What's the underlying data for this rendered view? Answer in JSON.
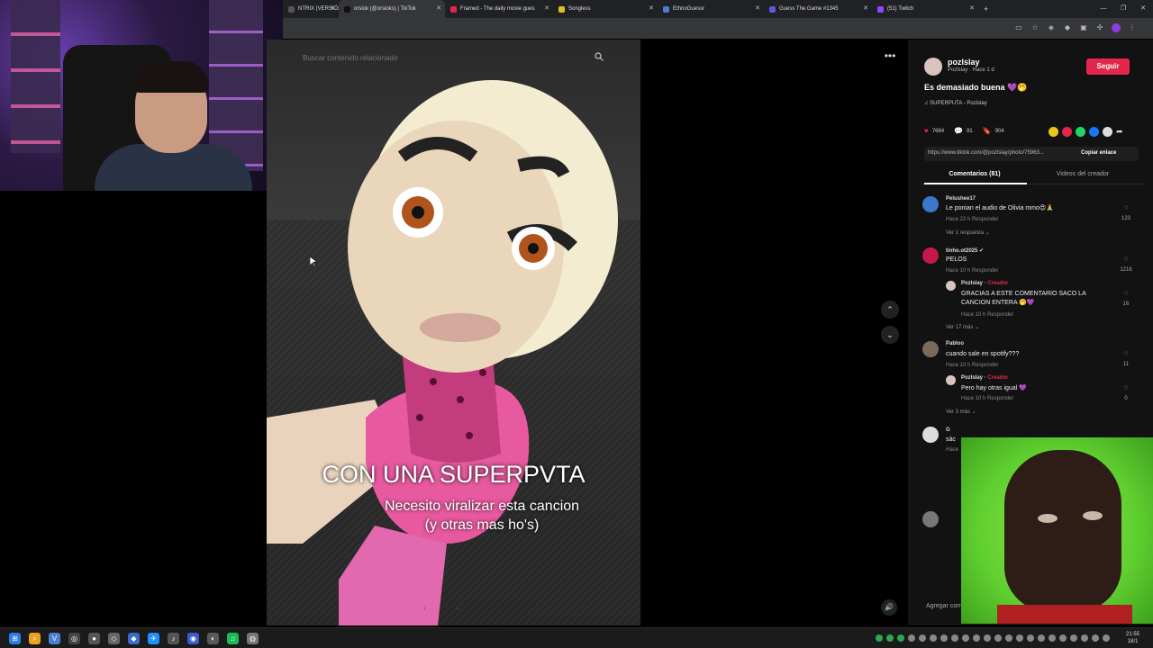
{
  "browser": {
    "tabs": [
      {
        "label": "NTRIX (VERSIÓN",
        "color": "#555555"
      },
      {
        "label": "orsiok (@orsioks) | TikTok",
        "color": "#111111",
        "active": true
      },
      {
        "label": "Framed - The daily movie gues",
        "color": "#e3274c"
      },
      {
        "label": "Songless",
        "color": "#e0c020"
      },
      {
        "label": "EthnoGuessr",
        "color": "#4a7fd0"
      },
      {
        "label": "Guess The.Game #1345",
        "color": "#5a5ae0"
      },
      {
        "label": "(51) Twitch",
        "color": "#9146ff"
      }
    ],
    "new_tab": "+",
    "window_controls": [
      "—",
      "❐",
      "✕"
    ]
  },
  "video": {
    "search_placeholder": "Buscar contenido relacionado",
    "caption_big": "CON UNA SUPERPVTA",
    "caption_small": "Necesito viralizar esta cancion (y otras mas ho's)",
    "more_icon": "•••",
    "up_icon": "⌃",
    "down_icon": "⌄",
    "volume_icon": "🔊",
    "pager": "‹ ›"
  },
  "panel": {
    "username": "pozlslay",
    "subline": "Pozlslay · Hace 1 d",
    "follow_label": "Seguir",
    "description": "Es demasiado buena 💜🤭",
    "music": "♫ SUPERPUTA - Pozlslay",
    "stats": {
      "likes": "7684",
      "comments": "81",
      "saves": "904"
    },
    "share_colors": [
      "#f0c419",
      "#e3274c",
      "#25d366",
      "#1877f2",
      "#dddddd"
    ],
    "link_url": "https://www.tiktok.com/@pozlslay/photo/75963...",
    "copy_link": "Copiar enlace",
    "tab_comments": "Comentarios (81)",
    "tab_creator": "Videos del creador",
    "add_comment": "Agregar com"
  },
  "comments": [
    {
      "name": "Pelushee17",
      "text": "Le ponian el audio de Olivia mmo😍🙏",
      "meta": "Hace 22 h    Responder",
      "likes": "123",
      "more": "Ver 1 respuesta ⌄",
      "avatar_color": "#3b78c9"
    },
    {
      "name": "tinho.ot2025 ✔",
      "text": "PELOS",
      "meta": "Hace 10 h    Responder",
      "likes": "1216",
      "avatar_color": "#c2184a",
      "reply": {
        "name": "Pozlslay · ",
        "tag": "Creador",
        "text": "GRACIAS A ESTE COMENTARIO SACO LA CANCION ENTERA 🤭💜",
        "meta": "Hace 10 h    Responder",
        "likes": "16"
      },
      "more": "Ver 17 más ⌄"
    },
    {
      "name": "Pabloo",
      "text": "cuando sale en spotify???",
      "meta": "Hace 10 h    Responder",
      "likes": "11",
      "avatar_color": "#7a6a5a",
      "reply": {
        "name": "Pozlslay · ",
        "tag": "Creador",
        "text": "Pero hay otras igual 💜",
        "meta": "Hace 10 h    Responder",
        "likes": "0"
      },
      "more": "Ver 3 más ⌄"
    },
    {
      "name": "G",
      "text": "sác",
      "meta": "Hace",
      "likes": "",
      "avatar_color": "#dddddd"
    }
  ],
  "taskbar": {
    "icons": [
      "⊞",
      "⌕",
      "V",
      "◎",
      "●",
      "◇",
      "◆",
      "✈",
      "♪",
      "◉",
      "◐",
      "♫",
      "◍"
    ],
    "clock_time": "21:55",
    "clock_date": "18/1"
  }
}
